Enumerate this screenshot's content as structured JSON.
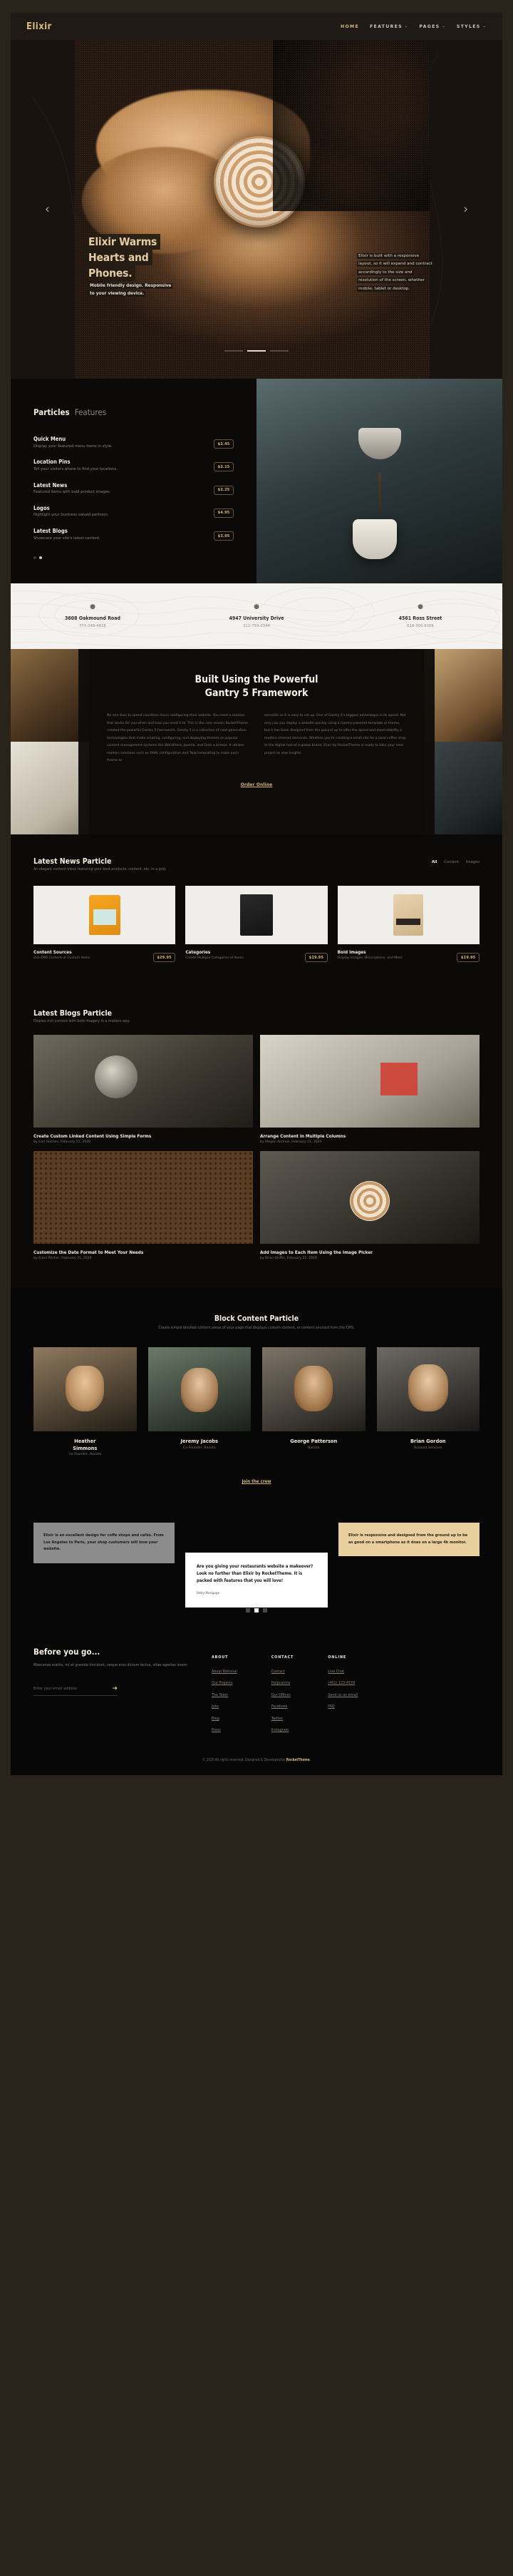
{
  "header": {
    "brand": "Elixir",
    "nav": [
      {
        "label": "HOME",
        "caret": "",
        "active": true
      },
      {
        "label": "FEATURES",
        "caret": "⌄",
        "active": false
      },
      {
        "label": "PAGES",
        "caret": "⌄",
        "active": false
      },
      {
        "label": "STYLES",
        "caret": "⌄",
        "active": false
      }
    ]
  },
  "hero": {
    "prev_icon": "‹",
    "next_icon": "›",
    "title_lines": [
      "Elixir Warms",
      "Hearts and",
      "Phones."
    ],
    "subtitle_lines": [
      "Mobile friendly design. Responsive",
      "to your viewing device."
    ],
    "right_lines": [
      "Elixir is built with a responsive",
      "layout, so it will expand and contract",
      "accordingly to the size and",
      "resolution of the screen, whether",
      "mobile, tablet or desktop."
    ],
    "slide_count": 3,
    "active_slide": 2
  },
  "particles": {
    "heading_bold": "Particles",
    "heading_light": "Features",
    "items": [
      {
        "title": "Quick Menu",
        "desc": "Display your featured menu items in style.",
        "price": "$2.45"
      },
      {
        "title": "Location Pins",
        "desc": "Tell your visitors where to find your locations.",
        "price": "$2.15"
      },
      {
        "title": "Latest News",
        "desc": "Featured items with bold product images.",
        "price": "$2.25"
      },
      {
        "title": "Logos",
        "desc": "Highlight your business valued partners.",
        "price": "$4.95"
      },
      {
        "title": "Latest Blogs",
        "desc": "Showcase your site's latest content.",
        "price": "$3.95"
      }
    ],
    "dot_count": 2,
    "active_dot": 1
  },
  "locations": [
    {
      "pin": "pin-icon",
      "address": "3608 Oakmound Road",
      "phone": "773-248-4838"
    },
    {
      "pin": "pin-icon",
      "address": "4947 University Drive",
      "phone": "312-759-0344"
    },
    {
      "pin": "pin-icon",
      "address": "4561 Ross Street",
      "phone": "618-300-6306"
    }
  ],
  "gantry": {
    "title_lines": [
      "Built Using the Powerful",
      "Gantry 5 Framework"
    ],
    "col_left": "No one likes to spend countless hours configuring their website. You need a solution that works for you when and how you need it to. This is the core reason RocketTheme created the powerful Gantry 5 framework. Gantry 5 is a collection of next-generation technologies that make creating, configuring, and deploying themes on popular content management systems like WordPress, Joomla, and Grav a breeze. It utilizes modern solutions such as YAML configuration and Twig templating to make each theme as",
    "col_right": "versatile as it is easy to set up. One of Gantry 5's biggest advantages is its speed. Not only can you deploy a website quickly using a Gantry-powered template or theme, but it has been designed from the ground up to offer the speed and dependability a modern internet demands. Whether you're creating a small site for a local coffee shop or the digital hub of a global brand, Elixir by RocketTheme is ready to take your next project to new heights.",
    "cta": "Order Online"
  },
  "news": {
    "heading": "Latest News Particle",
    "subheading": "An elegant content block featuring your best products, content, etc. in a grid.",
    "filters": [
      {
        "label": "All",
        "active": true
      },
      {
        "label": "Content",
        "active": false
      },
      {
        "label": "Images",
        "active": false
      }
    ],
    "cards": [
      {
        "title": "Content Sources",
        "desc": "Use CMS Content or Custom Items",
        "price": "$29.95",
        "img": "orange-coffee-bag"
      },
      {
        "title": "Categories",
        "desc": "Create Multiple Categories of Items",
        "price": "$19.95",
        "img": "black-coffee-bag"
      },
      {
        "title": "Bold Images",
        "desc": "Display Images, Descriptions, and More",
        "price": "$19.95",
        "img": "kraft-coffee-bag"
      }
    ]
  },
  "blogs": {
    "heading": "Latest Blogs Particle",
    "subheading": "Display rich content with bold imagery in a modern way.",
    "cards": [
      {
        "title": "Create Custom Linked Content Using Simple Forms",
        "meta": "by Carl Holmes, February 21, 2020",
        "img": "pour-over-setup"
      },
      {
        "title": "Arrange Content in Multiple Columns",
        "meta": "by Megan Andrew, February 21, 2020",
        "img": "flatlay-desk"
      },
      {
        "title": "Customize the Date Format to Meet Your Needs",
        "meta": "by Carol Pitcher, February 21, 2020",
        "img": "coffee-beans"
      },
      {
        "title": "Add Images to Each Item Using the Image Picker",
        "meta": "by Brian Griffin, February 21, 2020",
        "img": "latte-art"
      }
    ]
  },
  "team": {
    "heading": "Block Content Particle",
    "subheading": "Create simple blocked content areas of your page that displays custom content, or content sourced from the CMS.",
    "members": [
      {
        "name_lines": [
          "Heather",
          "Simmons"
        ],
        "role": "Co-Founder, Barista"
      },
      {
        "name_lines": [
          "Jeremy Jacobs"
        ],
        "role": "Co-Founder, Barista"
      },
      {
        "name_lines": [
          "George Patterson"
        ],
        "role": "Barista"
      },
      {
        "name_lines": [
          "Brian Gordon"
        ],
        "role": "Account Services"
      }
    ],
    "cta": "Join the crew"
  },
  "testimonials": {
    "left": {
      "quote": "Elixir is an excellent design for coffe shops and cafés. From Los Angeles to Paris, your shop customers will love your website.",
      "author": ""
    },
    "right": {
      "quote": "Elixir is responsive and designed from the ground up to be as good on a smartphone as it does on a large 4k monitor.",
      "author": ""
    },
    "center": {
      "quote": "Are you giving your restaurants website a makeover? Look no further than Elixir by RocketTheme. It is packed with features that you will love!",
      "author": "Betty Mortgage"
    },
    "dot_count": 3,
    "active_dot": 2
  },
  "footer": {
    "heading": "Before you go...",
    "paragraph": "Maecenas mattis, mi et gravida tincidunt, neque eros dictum lectus, vitae egestas lorem.",
    "email_placeholder": "Enter your email address",
    "submit_icon": "➜",
    "columns": [
      {
        "title": "ABOUT",
        "links": [
          "About Rational",
          "Our Projects",
          "The Team",
          "Jobs",
          "Blog",
          "Press"
        ]
      },
      {
        "title": "CONTACT",
        "links": [
          "Contact",
          "Helpcentre",
          "Our Offices",
          "Facebook",
          "Twitter",
          "Instagram"
        ]
      },
      {
        "title": "ONLINE",
        "links": [
          "Live Chat",
          "(401) 123-4578",
          "Send us an email",
          "FAQ"
        ]
      }
    ],
    "copyright_prefix": "© 2020 All rights reserved. Designed & Developed by ",
    "copyright_brand": "RocketTheme",
    "copyright_suffix": "."
  },
  "colors": {
    "accent": "#d8b87f",
    "page_bg": "#2a231b",
    "dark_bg": "#0b0a09",
    "light_bg": "#f3f2ef"
  }
}
